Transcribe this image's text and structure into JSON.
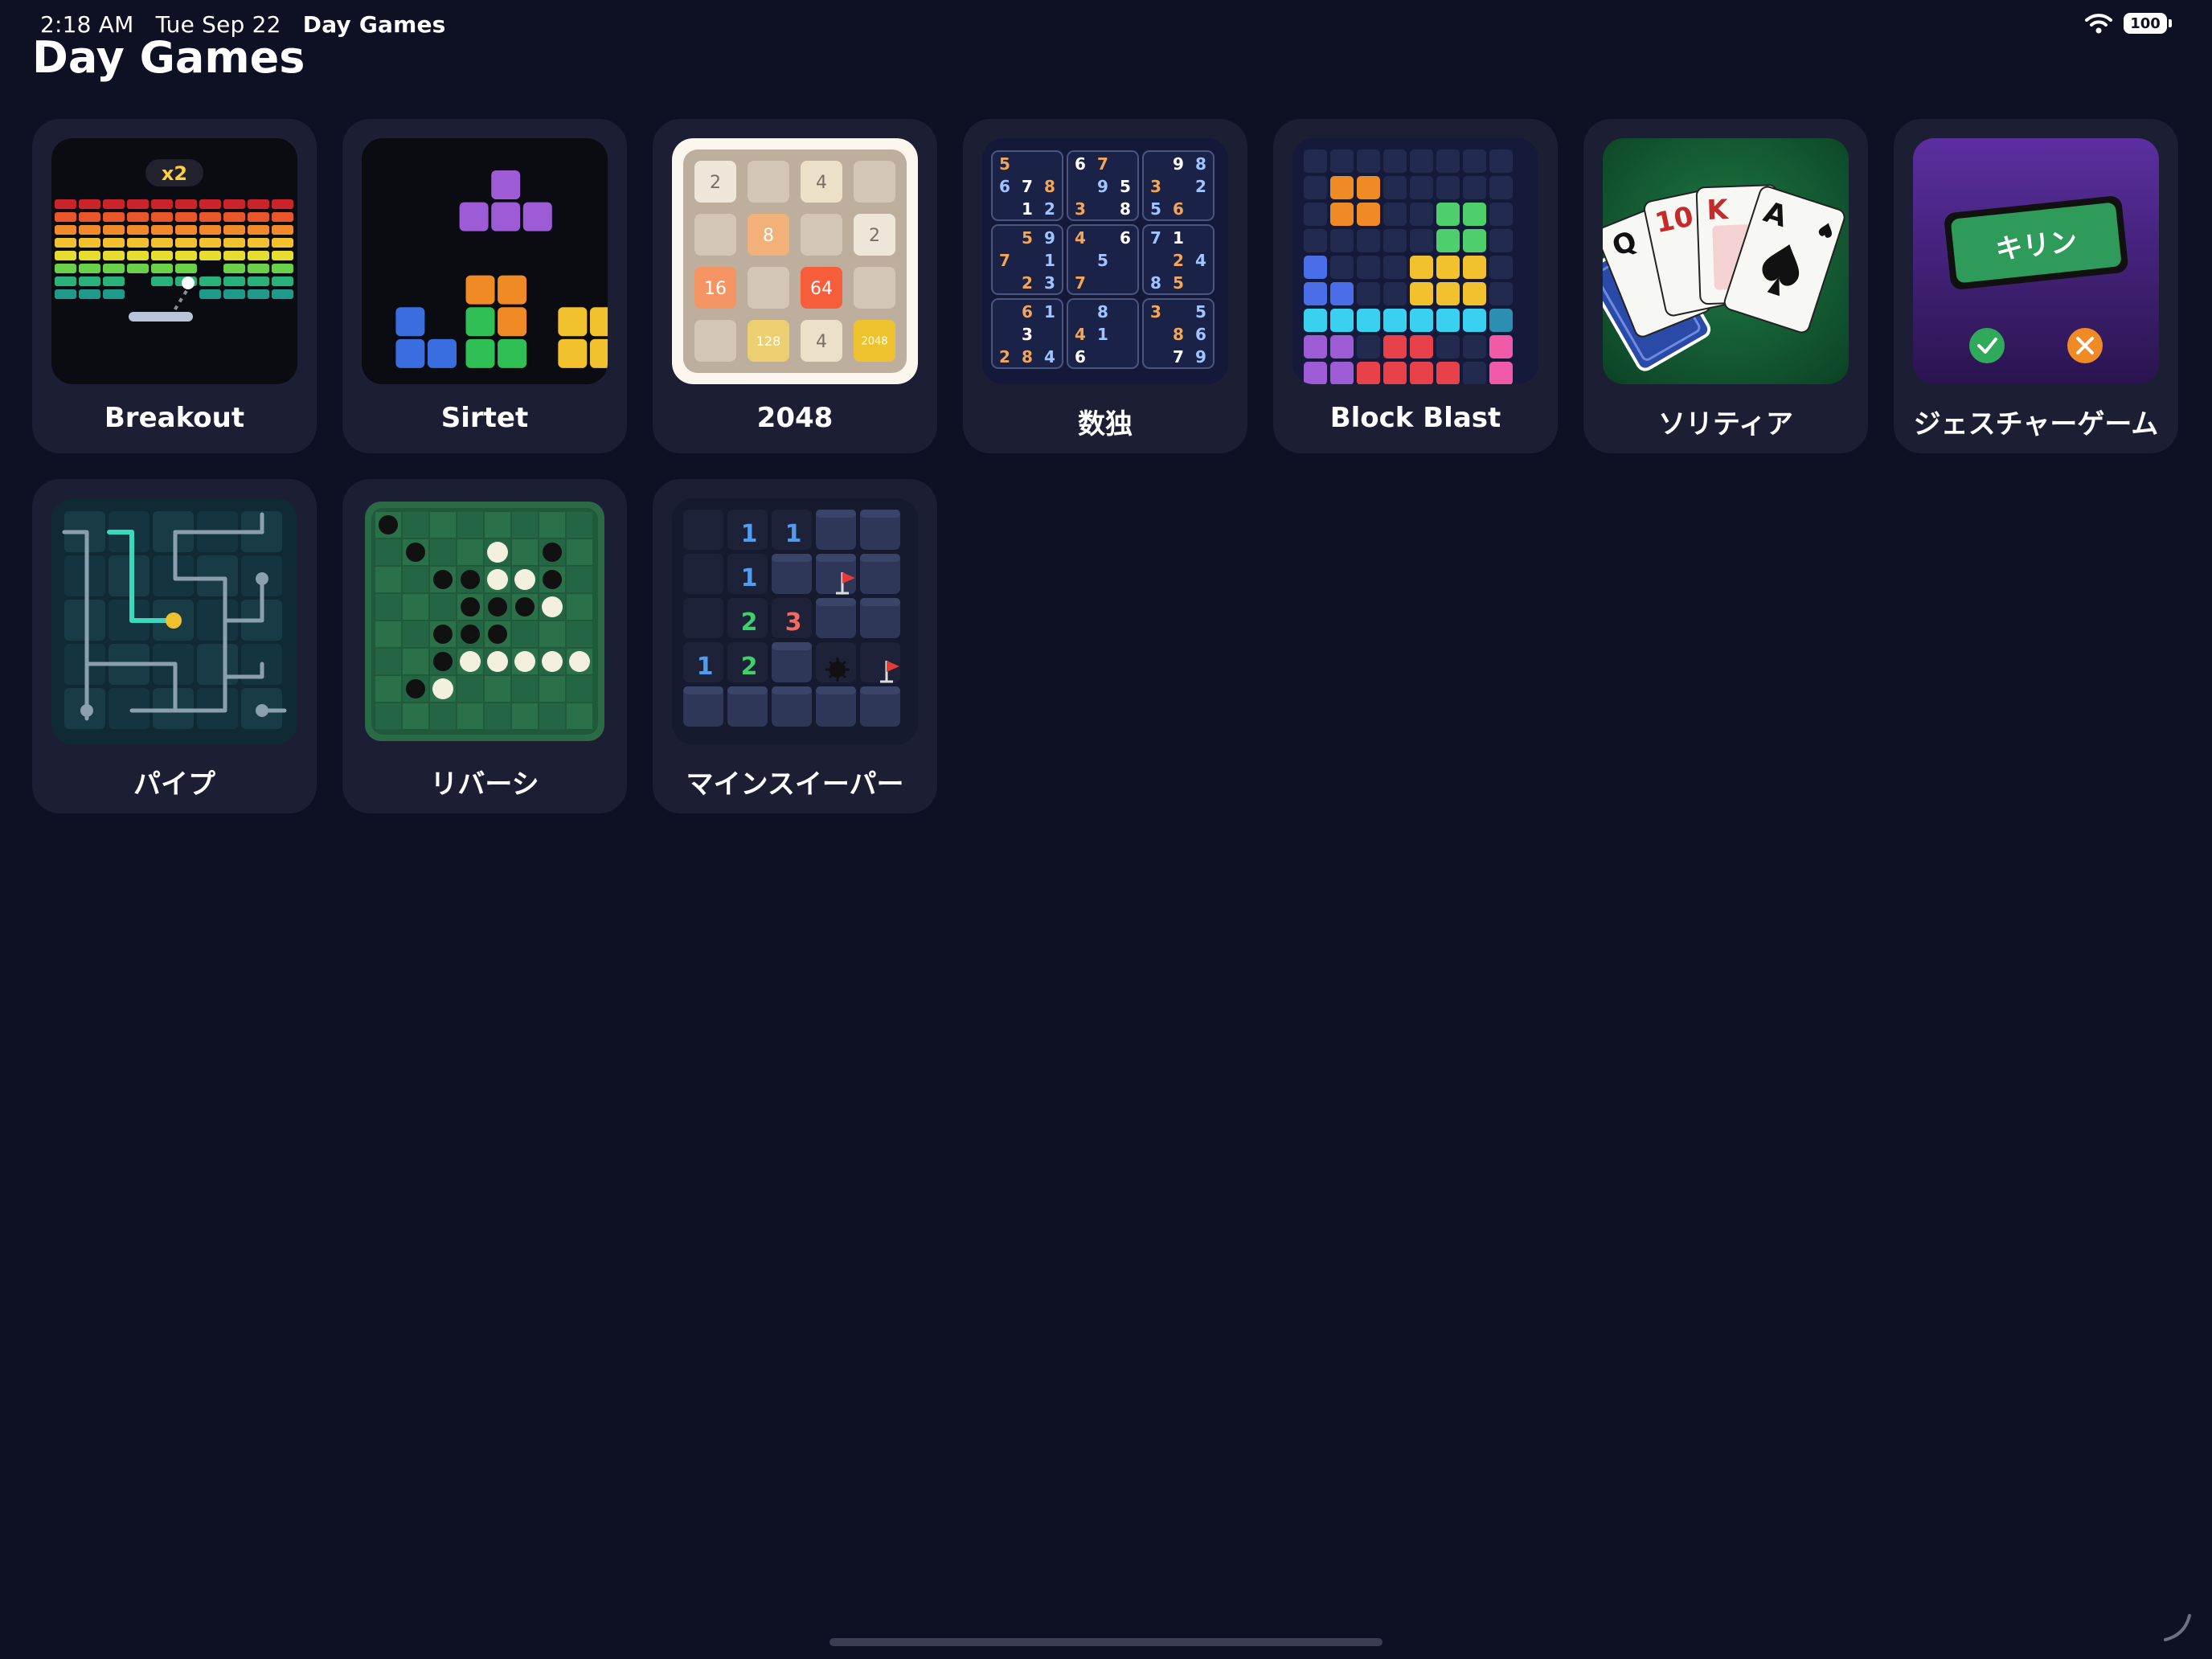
{
  "status_bar": {
    "time": "2:18 AM",
    "date": "Tue Sep 22",
    "app_name": "Day Games",
    "battery": "100",
    "wifi_icon": "wifi-icon"
  },
  "page": {
    "title": "Day Games"
  },
  "games": [
    {
      "id": "breakout",
      "label": "Breakout",
      "multiplier": "x2"
    },
    {
      "id": "sirtet",
      "label": "Sirtet"
    },
    {
      "id": "2048",
      "label": "2048",
      "tiles": [
        "2",
        "",
        "4",
        "",
        "",
        "8",
        "",
        "2",
        "16",
        "",
        "64",
        "",
        "",
        "128",
        "4",
        "2048"
      ]
    },
    {
      "id": "sudoku",
      "label": "数独",
      "grid": [
        [
          "5",
          "",
          "",
          "6",
          "7",
          "",
          "",
          "9",
          "8"
        ],
        [
          "6",
          "7",
          "8",
          "",
          "9",
          "5",
          "3",
          "",
          "2"
        ],
        [
          "",
          "1",
          "2",
          "3",
          "",
          "8",
          "5",
          "6",
          ""
        ],
        [
          "",
          "5",
          "9",
          "4",
          "",
          "6",
          "7",
          "1",
          ""
        ],
        [
          "7",
          "",
          "1",
          "",
          "5",
          "",
          "",
          "2",
          "4"
        ],
        [
          "",
          "2",
          "3",
          "7",
          "",
          "",
          "8",
          "5",
          ""
        ],
        [
          "",
          "6",
          "1",
          "",
          "8",
          "",
          "3",
          "",
          "5"
        ],
        [
          "",
          "3",
          "",
          "4",
          "1",
          "",
          "",
          "8",
          "6"
        ],
        [
          "2",
          "8",
          "4",
          "6",
          "",
          "",
          "",
          "7",
          "9"
        ]
      ]
    },
    {
      "id": "block-blast",
      "label": "Block Blast"
    },
    {
      "id": "solitaire",
      "label": "ソリティア",
      "cards": [
        "Q",
        "10",
        "K",
        "A"
      ]
    },
    {
      "id": "gesture",
      "label": "ジェスチャーゲーム",
      "word": "キリン"
    },
    {
      "id": "pipe",
      "label": "パイプ"
    },
    {
      "id": "reversi",
      "label": "リバーシ"
    },
    {
      "id": "minesweeper",
      "label": "マインスイーパー",
      "numbers": [
        [
          "1",
          "1"
        ],
        [
          "1"
        ],
        [
          "2",
          "3"
        ],
        [
          "1",
          "2"
        ]
      ]
    }
  ],
  "colors": {
    "background": "#0e1023",
    "card": "#1c1e33",
    "accent_green": "#2faa5a",
    "accent_orange": "#f08a24"
  }
}
